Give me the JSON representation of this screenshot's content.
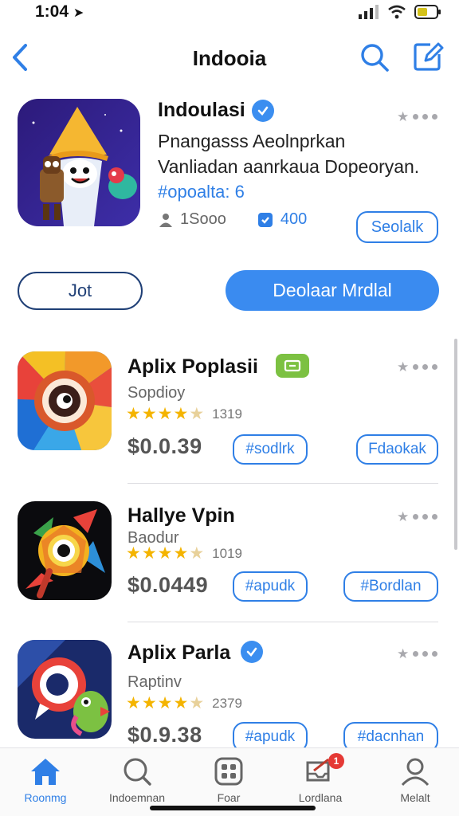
{
  "status_bar": {
    "time": "1:04"
  },
  "nav": {
    "title": "Indooia"
  },
  "featured": {
    "name": "Indoulasi",
    "desc_line1": "Pnangasss Aeolnprkan",
    "desc_line2": "Vanliadan aanrkaua Dopeoryan.",
    "tag": "#opoalta: 6",
    "stat_users": "1Sooo",
    "stat_downloads": "400",
    "select_label": "Seolalk",
    "jot_label": "Jot",
    "download_label": "Deolaar Mrdlal"
  },
  "apps": [
    {
      "name": "Aplix Poplasii",
      "subtitle": "Sopdioy",
      "rating_count": "1319",
      "price": "$0.0.39",
      "btn1": "#sodlrk",
      "btn2": "Fdaokak",
      "rating": 4.5
    },
    {
      "name": "Hallye Vpin",
      "subtitle": "Baodur",
      "rating_count": "1019",
      "price": "$0.0449",
      "btn1": "#apudk",
      "btn2": "#Bordlan",
      "rating": 4.5
    },
    {
      "name": "Aplix Parla",
      "subtitle": "Raptinv",
      "rating_count": "2379",
      "price": "$0.9.38",
      "btn1": "#apudk",
      "btn2": "#dacnhan",
      "rating": 4.5
    }
  ],
  "tabs": [
    {
      "label": "Roonmg",
      "icon": "home-icon",
      "active": true
    },
    {
      "label": "Indoemnan",
      "icon": "search-icon",
      "active": false
    },
    {
      "label": "Foar",
      "icon": "grid-icon",
      "active": false
    },
    {
      "label": "Lordlana",
      "icon": "inbox-icon",
      "active": false,
      "badge": "1"
    },
    {
      "label": "Melalt",
      "icon": "profile-icon",
      "active": false
    }
  ],
  "colors": {
    "accent": "#3a8bf0",
    "text": "#111111",
    "star": "#f4b400",
    "badge": "#e53935"
  }
}
